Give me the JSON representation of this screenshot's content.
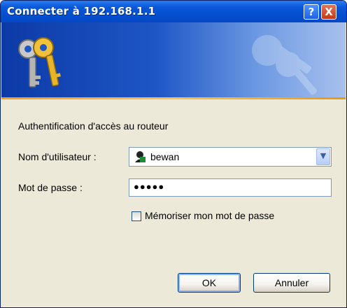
{
  "window": {
    "title": "Connecter à 192.168.1.1"
  },
  "title_buttons": {
    "help": "?",
    "close": "X"
  },
  "prompt": "Authentification d'accès au routeur",
  "username": {
    "label": "Nom d'utilisateur :",
    "value": "bewan"
  },
  "password": {
    "label": "Mot de passe :",
    "value": "●●●●●"
  },
  "remember": {
    "label": "Mémoriser mon mot de passe",
    "checked": false
  },
  "buttons": {
    "ok": "OK",
    "cancel": "Annuler"
  },
  "icons": {
    "keys": "keys-icon",
    "user": "user-icon",
    "dropdown": "chevron-down-icon"
  },
  "colors": {
    "titlebar": "#0550d0",
    "banner": "#1e56c6",
    "accent_line": "#f0a01e",
    "dialog_bg": "#ece9d8"
  }
}
